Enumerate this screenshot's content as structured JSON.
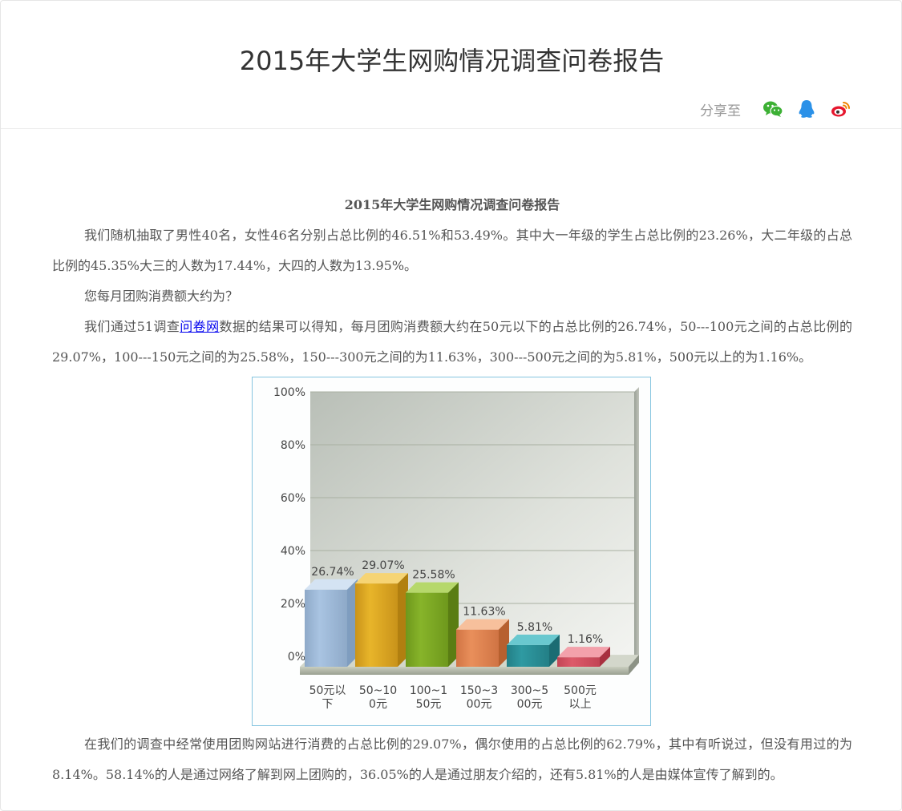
{
  "header": {
    "title": "2015年大学生网购情况调查问卷报告",
    "share_label": "分享至",
    "share_icons": [
      "wechat-icon",
      "qq-icon",
      "weibo-icon"
    ]
  },
  "article": {
    "subtitle": "2015年大学生网购情况调查问卷报告",
    "p1": "我们随机抽取了男性40名，女性46名分别占总比例的46.51%和53.49%。其中大一年级的学生占总比例的23.26%，大二年级的占总比例的45.35%大三的人数为17.44%，大四的人数为13.95%。",
    "p2": "您每月团购消费额大约为？",
    "p3_before": "我们通过51调查",
    "p3_link": "问卷网",
    "p3_after": "数据的结果可以得知，每月团购消费额大约在50元以下的占总比例的26.74%，50---100元之间的占总比例的29.07%，100---150元之间的为25.58%，150---300元之间的为11.63%，300---500元之间的为5.81%，500元以上的为1.16%。",
    "p4": "在我们的调查中经常使用团购网站进行消费的占总比例的29.07%，偶尔使用的占总比例的62.79%，其中有听说过，但没有用过的为8.14%。58.14%的人是通过网络了解到网上团购的，36.05%的人是通过朋友介绍的，还有5.81%的人是由媒体宣传了解到的。"
  },
  "chart_data": {
    "type": "bar",
    "categories": [
      [
        "50元以",
        "下"
      ],
      [
        "50~10",
        "0元"
      ],
      [
        "100~1",
        "50元"
      ],
      [
        "150~3",
        "00元"
      ],
      [
        "300~5",
        "00元"
      ],
      [
        "500元",
        "以上"
      ]
    ],
    "values": [
      26.74,
      29.07,
      25.58,
      11.63,
      5.81,
      1.16
    ],
    "value_labels": [
      "26.74%",
      "29.07%",
      "25.58%",
      "11.63%",
      "5.81%",
      "1.16%"
    ],
    "yticks": [
      "0%",
      "20%",
      "40%",
      "60%",
      "80%",
      "100%"
    ],
    "ylim": [
      0,
      100
    ],
    "grid": true,
    "colors": [
      {
        "front": "#a9c4e2",
        "top": "#d4e3f3",
        "side": "#7f9dbf",
        "dark": "#8ea9c8"
      },
      {
        "front": "#e8b52a",
        "top": "#f6d474",
        "side": "#b17f10",
        "dark": "#c9931a"
      },
      {
        "front": "#87b42a",
        "top": "#b6d86b",
        "side": "#5a7d13",
        "dark": "#6e981c"
      },
      {
        "front": "#e98f5b",
        "top": "#f7c09c",
        "side": "#b7602f",
        "dark": "#d07444"
      },
      {
        "front": "#2f9aa2",
        "top": "#69c8cf",
        "side": "#1b6c73",
        "dark": "#237f86"
      },
      {
        "front": "#dd5a6a",
        "top": "#f3a1ab",
        "side": "#a8303f",
        "dark": "#c24555"
      }
    ]
  }
}
